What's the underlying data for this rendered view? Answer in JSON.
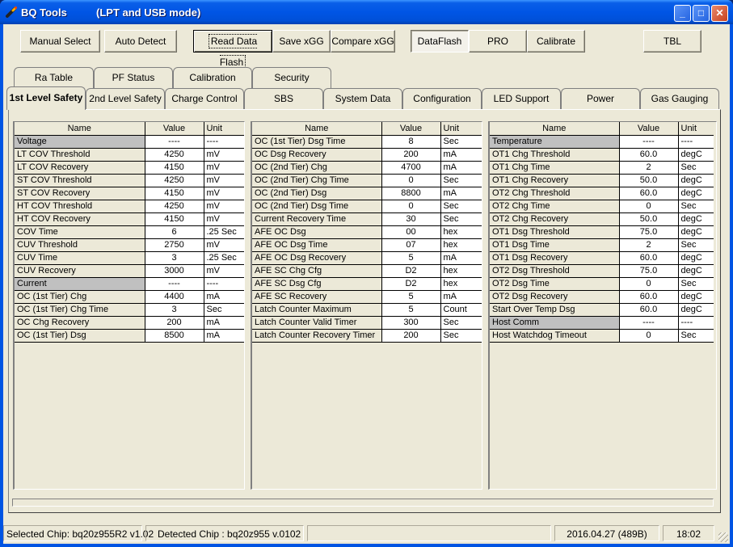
{
  "window": {
    "title": "BQ Tools",
    "mode": "(LPT and USB mode)",
    "icon": "soldering-iron-icon",
    "controls": {
      "minimize": "_",
      "maximize": "□",
      "close": "✕"
    }
  },
  "toolbar": {
    "manual_select": "Manual Select",
    "auto_detect": "Auto Detect",
    "read_data_flash": "Read Data Flash",
    "save_xgg": "Save xGG",
    "compare_xgg": "Compare xGG",
    "mode_tabs": [
      "DataFlash",
      "PRO",
      "Calibrate"
    ],
    "active_mode": "DataFlash",
    "tbl": "TBL"
  },
  "tabs": {
    "back_row": [
      "Ra Table",
      "PF Status",
      "Calibration",
      "Security"
    ],
    "front_row": [
      "1st Level Safety",
      "2nd Level Safety",
      "Charge Control",
      "SBS Configuration",
      "System Data",
      "Configuration",
      "LED Support",
      "Power",
      "Gas Gauging"
    ],
    "active": "1st Level Safety"
  },
  "grid_headers": {
    "name": "Name",
    "value": "Value",
    "unit": "Unit"
  },
  "grids": [
    {
      "rows": [
        {
          "name": "Voltage",
          "value": "----",
          "unit": "----",
          "section": true
        },
        {
          "name": "LT COV Threshold",
          "value": "4250",
          "unit": "mV"
        },
        {
          "name": "LT COV Recovery",
          "value": "4150",
          "unit": "mV"
        },
        {
          "name": "ST COV Threshold",
          "value": "4250",
          "unit": "mV"
        },
        {
          "name": "ST COV Recovery",
          "value": "4150",
          "unit": "mV"
        },
        {
          "name": "HT COV Threshold",
          "value": "4250",
          "unit": "mV"
        },
        {
          "name": "HT COV Recovery",
          "value": "4150",
          "unit": "mV"
        },
        {
          "name": "COV Time",
          "value": "6",
          "unit": ".25 Sec"
        },
        {
          "name": "CUV Threshold",
          "value": "2750",
          "unit": "mV"
        },
        {
          "name": "CUV Time",
          "value": "3",
          "unit": ".25 Sec"
        },
        {
          "name": "CUV Recovery",
          "value": "3000",
          "unit": "mV"
        },
        {
          "name": "Current",
          "value": "----",
          "unit": "----",
          "section": true
        },
        {
          "name": "OC (1st Tier) Chg",
          "value": "4400",
          "unit": "mA"
        },
        {
          "name": "OC (1st Tier) Chg Time",
          "value": "3",
          "unit": "Sec"
        },
        {
          "name": "OC Chg Recovery",
          "value": "200",
          "unit": "mA"
        },
        {
          "name": "OC (1st Tier) Dsg",
          "value": "8500",
          "unit": "mA"
        }
      ]
    },
    {
      "rows": [
        {
          "name": "OC (1st Tier) Dsg Time",
          "value": "8",
          "unit": "Sec"
        },
        {
          "name": "OC Dsg Recovery",
          "value": "200",
          "unit": "mA"
        },
        {
          "name": "OC (2nd Tier) Chg",
          "value": "4700",
          "unit": "mA"
        },
        {
          "name": "OC (2nd Tier) Chg Time",
          "value": "0",
          "unit": "Sec"
        },
        {
          "name": "OC (2nd Tier) Dsg",
          "value": "8800",
          "unit": "mA"
        },
        {
          "name": "OC (2nd Tier) Dsg Time",
          "value": "0",
          "unit": "Sec"
        },
        {
          "name": "Current Recovery Time",
          "value": "30",
          "unit": "Sec"
        },
        {
          "name": "AFE OC Dsg",
          "value": "00",
          "unit": "hex"
        },
        {
          "name": "AFE OC Dsg Time",
          "value": "07",
          "unit": "hex"
        },
        {
          "name": "AFE OC Dsg Recovery",
          "value": "5",
          "unit": "mA"
        },
        {
          "name": "AFE SC Chg Cfg",
          "value": "D2",
          "unit": "hex"
        },
        {
          "name": "AFE SC Dsg Cfg",
          "value": "D2",
          "unit": "hex"
        },
        {
          "name": "AFE SC Recovery",
          "value": "5",
          "unit": "mA"
        },
        {
          "name": "Latch Counter Maximum",
          "value": "5",
          "unit": "Count"
        },
        {
          "name": "Latch Counter Valid Timer",
          "value": "300",
          "unit": "Sec"
        },
        {
          "name": "Latch Counter Recovery Timer",
          "value": "200",
          "unit": "Sec"
        }
      ]
    },
    {
      "rows": [
        {
          "name": "Temperature",
          "value": "----",
          "unit": "----",
          "section": true
        },
        {
          "name": "OT1 Chg Threshold",
          "value": "60.0",
          "unit": "degC"
        },
        {
          "name": "OT1 Chg Time",
          "value": "2",
          "unit": "Sec"
        },
        {
          "name": "OT1 Chg Recovery",
          "value": "50.0",
          "unit": "degC"
        },
        {
          "name": "OT2 Chg Threshold",
          "value": "60.0",
          "unit": "degC"
        },
        {
          "name": "OT2 Chg Time",
          "value": "0",
          "unit": "Sec"
        },
        {
          "name": "OT2 Chg Recovery",
          "value": "50.0",
          "unit": "degC"
        },
        {
          "name": "OT1 Dsg Threshold",
          "value": "75.0",
          "unit": "degC"
        },
        {
          "name": "OT1 Dsg Time",
          "value": "2",
          "unit": "Sec"
        },
        {
          "name": "OT1 Dsg Recovery",
          "value": "60.0",
          "unit": "degC"
        },
        {
          "name": "OT2 Dsg Threshold",
          "value": "75.0",
          "unit": "degC"
        },
        {
          "name": "OT2 Dsg Time",
          "value": "0",
          "unit": "Sec"
        },
        {
          "name": "OT2 Dsg Recovery",
          "value": "60.0",
          "unit": "degC"
        },
        {
          "name": "Start Over Temp Dsg",
          "value": "60.0",
          "unit": "degC"
        },
        {
          "name": "Host Comm",
          "value": "----",
          "unit": "----",
          "section": true
        },
        {
          "name": "Host Watchdog Timeout",
          "value": "0",
          "unit": "Sec"
        }
      ]
    }
  ],
  "statusbar": {
    "selected_chip": "Selected Chip: bq20z955R2 v1.02",
    "detected_chip": "Detected Chip : bq20z955  v.0102",
    "empty": "",
    "date": "2016.04.27  (489B)",
    "time": "18:02"
  }
}
